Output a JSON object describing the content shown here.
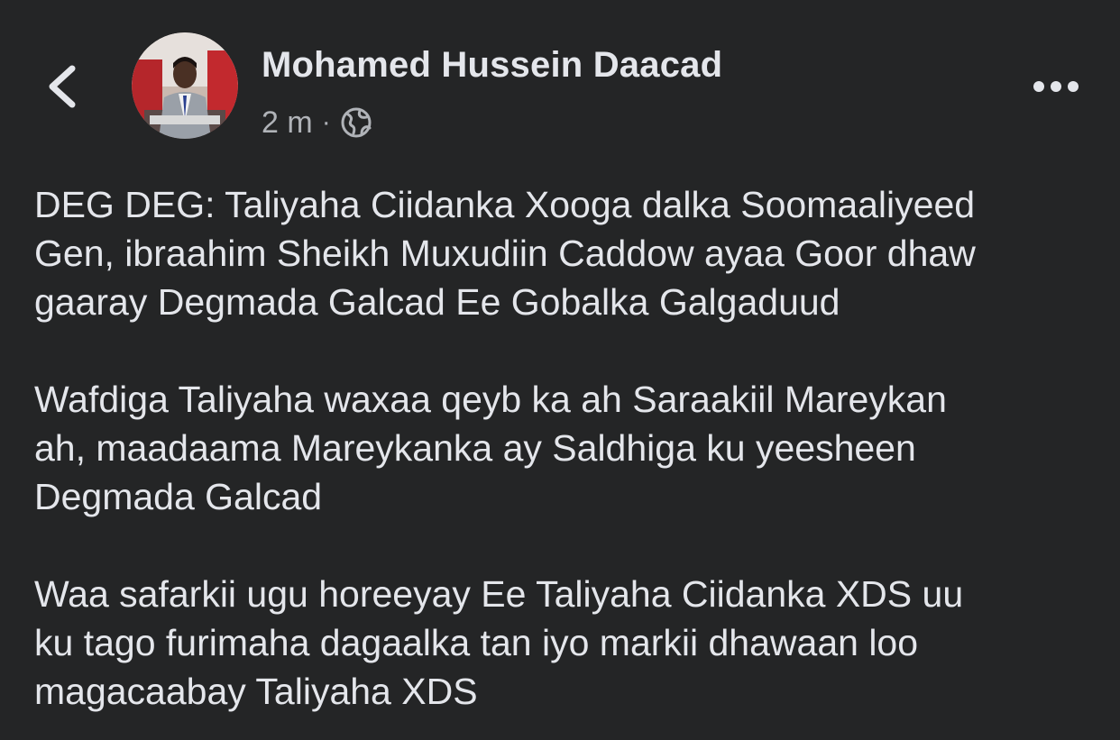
{
  "header": {
    "back_icon": "chevron-left-icon",
    "author_name": "Mohamed Hussein Daacad",
    "timestamp": "2 m",
    "separator": "·",
    "privacy_icon": "globe-icon",
    "more_icon": "more-horizontal-icon"
  },
  "post": {
    "paragraphs": [
      "DEG DEG: Taliyaha Ciidanka Xooga dalka Soomaaliyeed\nGen, ibraahim Sheikh Muxudiin Caddow ayaa Goor dhaw\ngaaray Degmada Galcad Ee Gobalka Galgaduud",
      "Wafdiga Taliyaha waxaa qeyb ka ah Saraakiil Mareykan\nah, maadaama Mareykanka ay Saldhiga ku yeesheen\nDegmada Galcad",
      "Waa safarkii ugu horeeyay Ee Taliyaha Ciidanka XDS uu\nku tago furimaha dagaalka tan iyo markii dhawaan loo\nmagacaabay Taliyaha XDS"
    ]
  },
  "colors": {
    "background": "#242526",
    "primary_text": "#e4e6eb",
    "secondary_text": "#b0b3b8"
  }
}
